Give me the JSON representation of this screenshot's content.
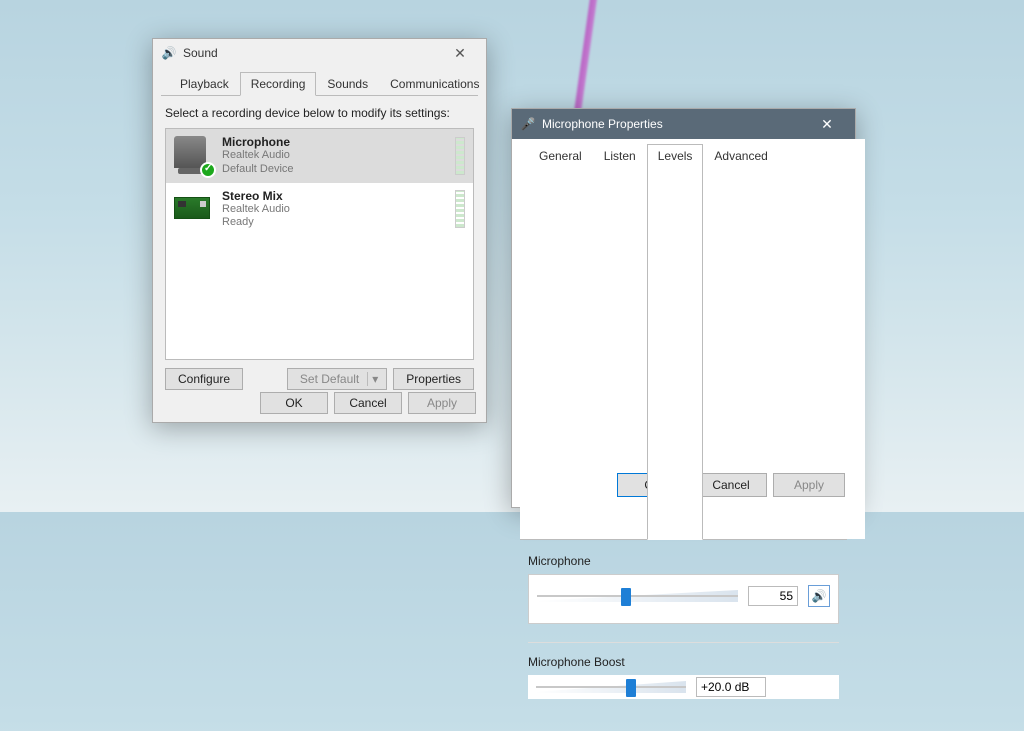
{
  "sound": {
    "title": "Sound",
    "tabs": [
      "Playback",
      "Recording",
      "Sounds",
      "Communications"
    ],
    "active_tab": 1,
    "instruction": "Select a recording device below to modify its settings:",
    "devices": [
      {
        "name": "Microphone",
        "driver": "Realtek Audio",
        "status": "Default Device",
        "selected": true,
        "checked": true,
        "icon": "mic"
      },
      {
        "name": "Stereo Mix",
        "driver": "Realtek Audio",
        "status": "Ready",
        "selected": false,
        "checked": false,
        "icon": "board"
      }
    ],
    "buttons": {
      "configure": "Configure",
      "set_default": "Set Default",
      "properties": "Properties",
      "ok": "OK",
      "cancel": "Cancel",
      "apply": "Apply"
    }
  },
  "props": {
    "title": "Microphone Properties",
    "tabs": [
      "General",
      "Listen",
      "Levels",
      "Advanced"
    ],
    "active_tab": 2,
    "microphone": {
      "label": "Microphone",
      "value": "55",
      "pct": 42
    },
    "boost": {
      "label": "Microphone Boost",
      "value": "+20.0 dB",
      "pct": 60
    },
    "buttons": {
      "ok": "OK",
      "cancel": "Cancel",
      "apply": "Apply"
    }
  }
}
